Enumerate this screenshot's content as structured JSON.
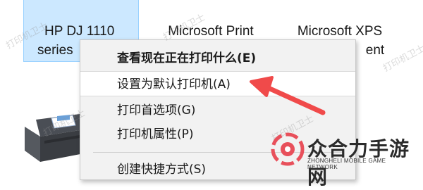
{
  "printers": [
    {
      "line1": "HP DJ 1110",
      "line2": "series"
    },
    {
      "line1": "Microsoft Print",
      "line2": ""
    },
    {
      "line1": "Microsoft XPS",
      "line2": "ent"
    }
  ],
  "context_menu": {
    "items": [
      {
        "label": "查看现在正在打印什么(E)",
        "bold": true
      },
      {
        "label": "设置为默认打印机(A)",
        "highlighted": true
      },
      {
        "label": "打印首选项(G)"
      },
      {
        "label": "打印机属性(P)"
      },
      {
        "label": "创建快捷方式(S)"
      }
    ]
  },
  "annotation": {
    "color": "#f04a4a"
  },
  "watermarks": [
    "打印机卫士",
    "打印机卫士",
    "打印机卫士",
    "打印机卫士",
    "打印机卫士"
  ],
  "site_logo": {
    "name": "众合力手游网",
    "tagline": "ZHONGHELI MOBILE GAME NETWORK",
    "colors": {
      "accent": "#e8505b",
      "text": "#2b2b2b"
    }
  },
  "icons": [
    "printer-icon",
    "red-arrow-icon",
    "site-logo-icon"
  ]
}
